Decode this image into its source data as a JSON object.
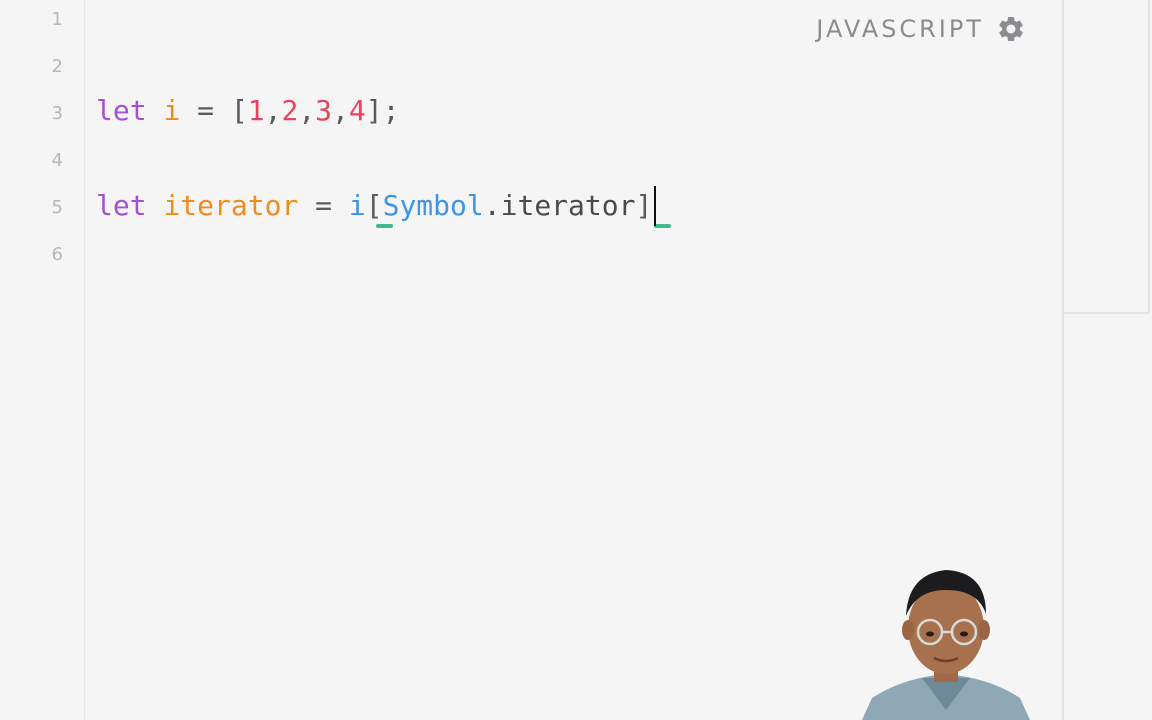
{
  "editor": {
    "language_label": "JAVASCRIPT",
    "settings_icon": "gear-icon",
    "line_numbers": [
      "1",
      "2",
      "3",
      "4",
      "5",
      "6"
    ],
    "lines": [
      {
        "tokens": []
      },
      {
        "tokens": []
      },
      {
        "tokens": [
          {
            "t": "let",
            "c": "kw"
          },
          {
            "t": " ",
            "c": "plain"
          },
          {
            "t": "i",
            "c": "var"
          },
          {
            "t": " = ",
            "c": "punc"
          },
          {
            "t": "[",
            "c": "punc"
          },
          {
            "t": "1",
            "c": "num"
          },
          {
            "t": ",",
            "c": "punc"
          },
          {
            "t": "2",
            "c": "num"
          },
          {
            "t": ",",
            "c": "punc"
          },
          {
            "t": "3",
            "c": "num"
          },
          {
            "t": ",",
            "c": "punc"
          },
          {
            "t": "4",
            "c": "num"
          },
          {
            "t": "];",
            "c": "punc"
          }
        ]
      },
      {
        "tokens": []
      },
      {
        "tokens": [
          {
            "t": "let",
            "c": "kw"
          },
          {
            "t": " ",
            "c": "plain"
          },
          {
            "t": "iterator",
            "c": "var"
          },
          {
            "t": " = ",
            "c": "punc"
          },
          {
            "t": "i",
            "c": "prop"
          },
          {
            "t": "[",
            "c": "punc"
          },
          {
            "t": "Symbol",
            "c": "prop"
          },
          {
            "t": ".iterator",
            "c": "plain"
          },
          {
            "t": "]",
            "c": "punc"
          }
        ]
      },
      {
        "tokens": []
      }
    ]
  },
  "colors": {
    "keyword": "#a64fd6",
    "variable": "#f08c1c",
    "number": "#e8445f",
    "property": "#3c96e6",
    "bracket_match": "#3fb88a"
  }
}
